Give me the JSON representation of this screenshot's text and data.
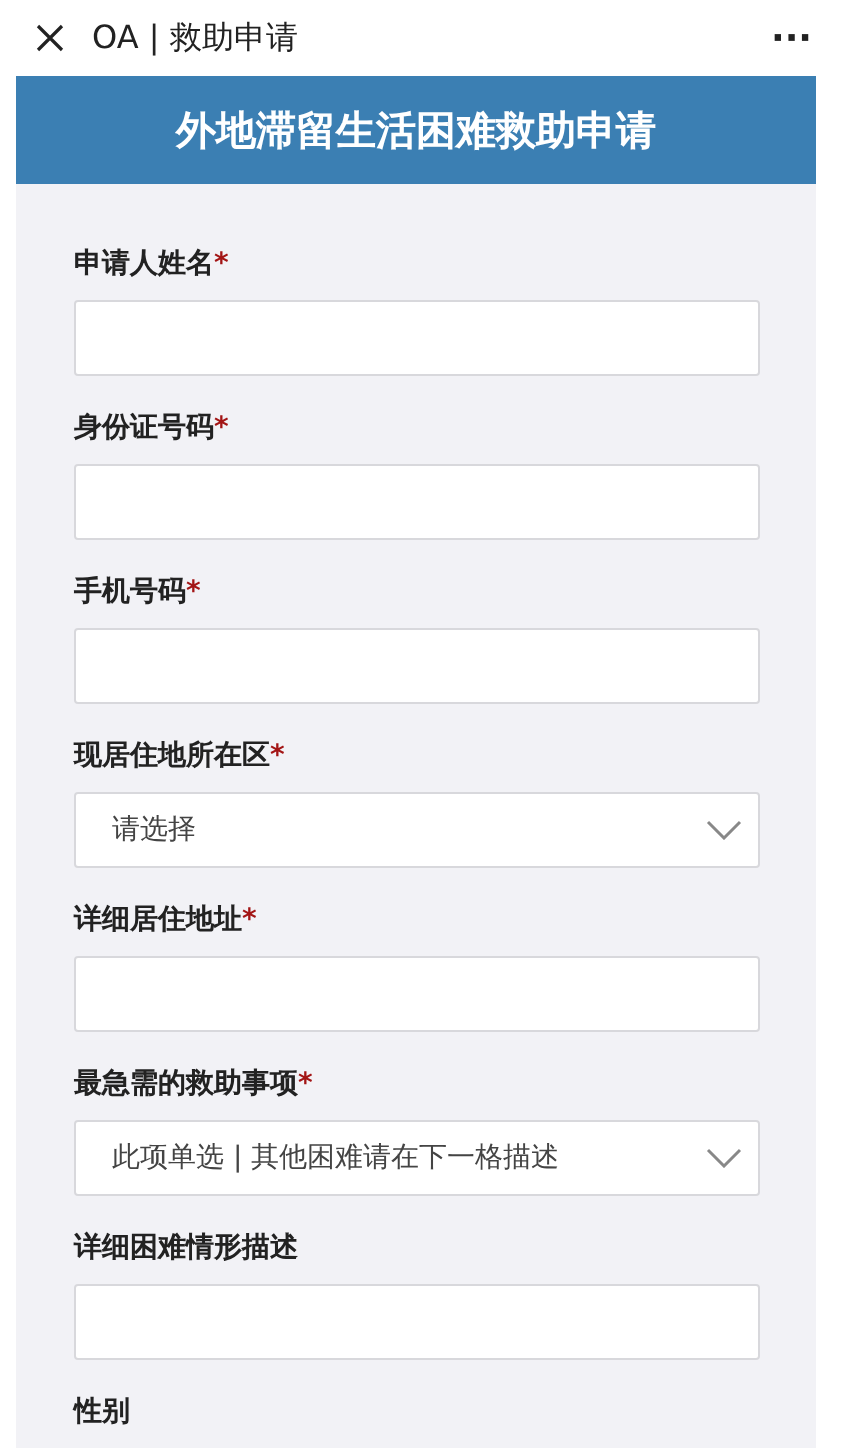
{
  "top_bar": {
    "title": "OA | 救助申请",
    "more": "···"
  },
  "header": {
    "title": "外地滞留生活困难救助申请"
  },
  "fields": [
    {
      "kind": "text",
      "label": "申请人姓名",
      "required_mark": "*"
    },
    {
      "kind": "text",
      "label": "身份证号码",
      "required_mark": "*"
    },
    {
      "kind": "text",
      "label": "手机号码",
      "required_mark": "*"
    },
    {
      "kind": "select",
      "label": "现居住地所在区",
      "required_mark": "*",
      "value": "请选择"
    },
    {
      "kind": "text",
      "label": "详细居住地址",
      "required_mark": "*"
    },
    {
      "kind": "select",
      "label": "最急需的救助事项",
      "required_mark": "*",
      "value": "此项单选 | 其他困难请在下一格描述"
    },
    {
      "kind": "text",
      "label": "详细困难情形描述"
    },
    {
      "kind": "label",
      "label": "性别"
    }
  ]
}
